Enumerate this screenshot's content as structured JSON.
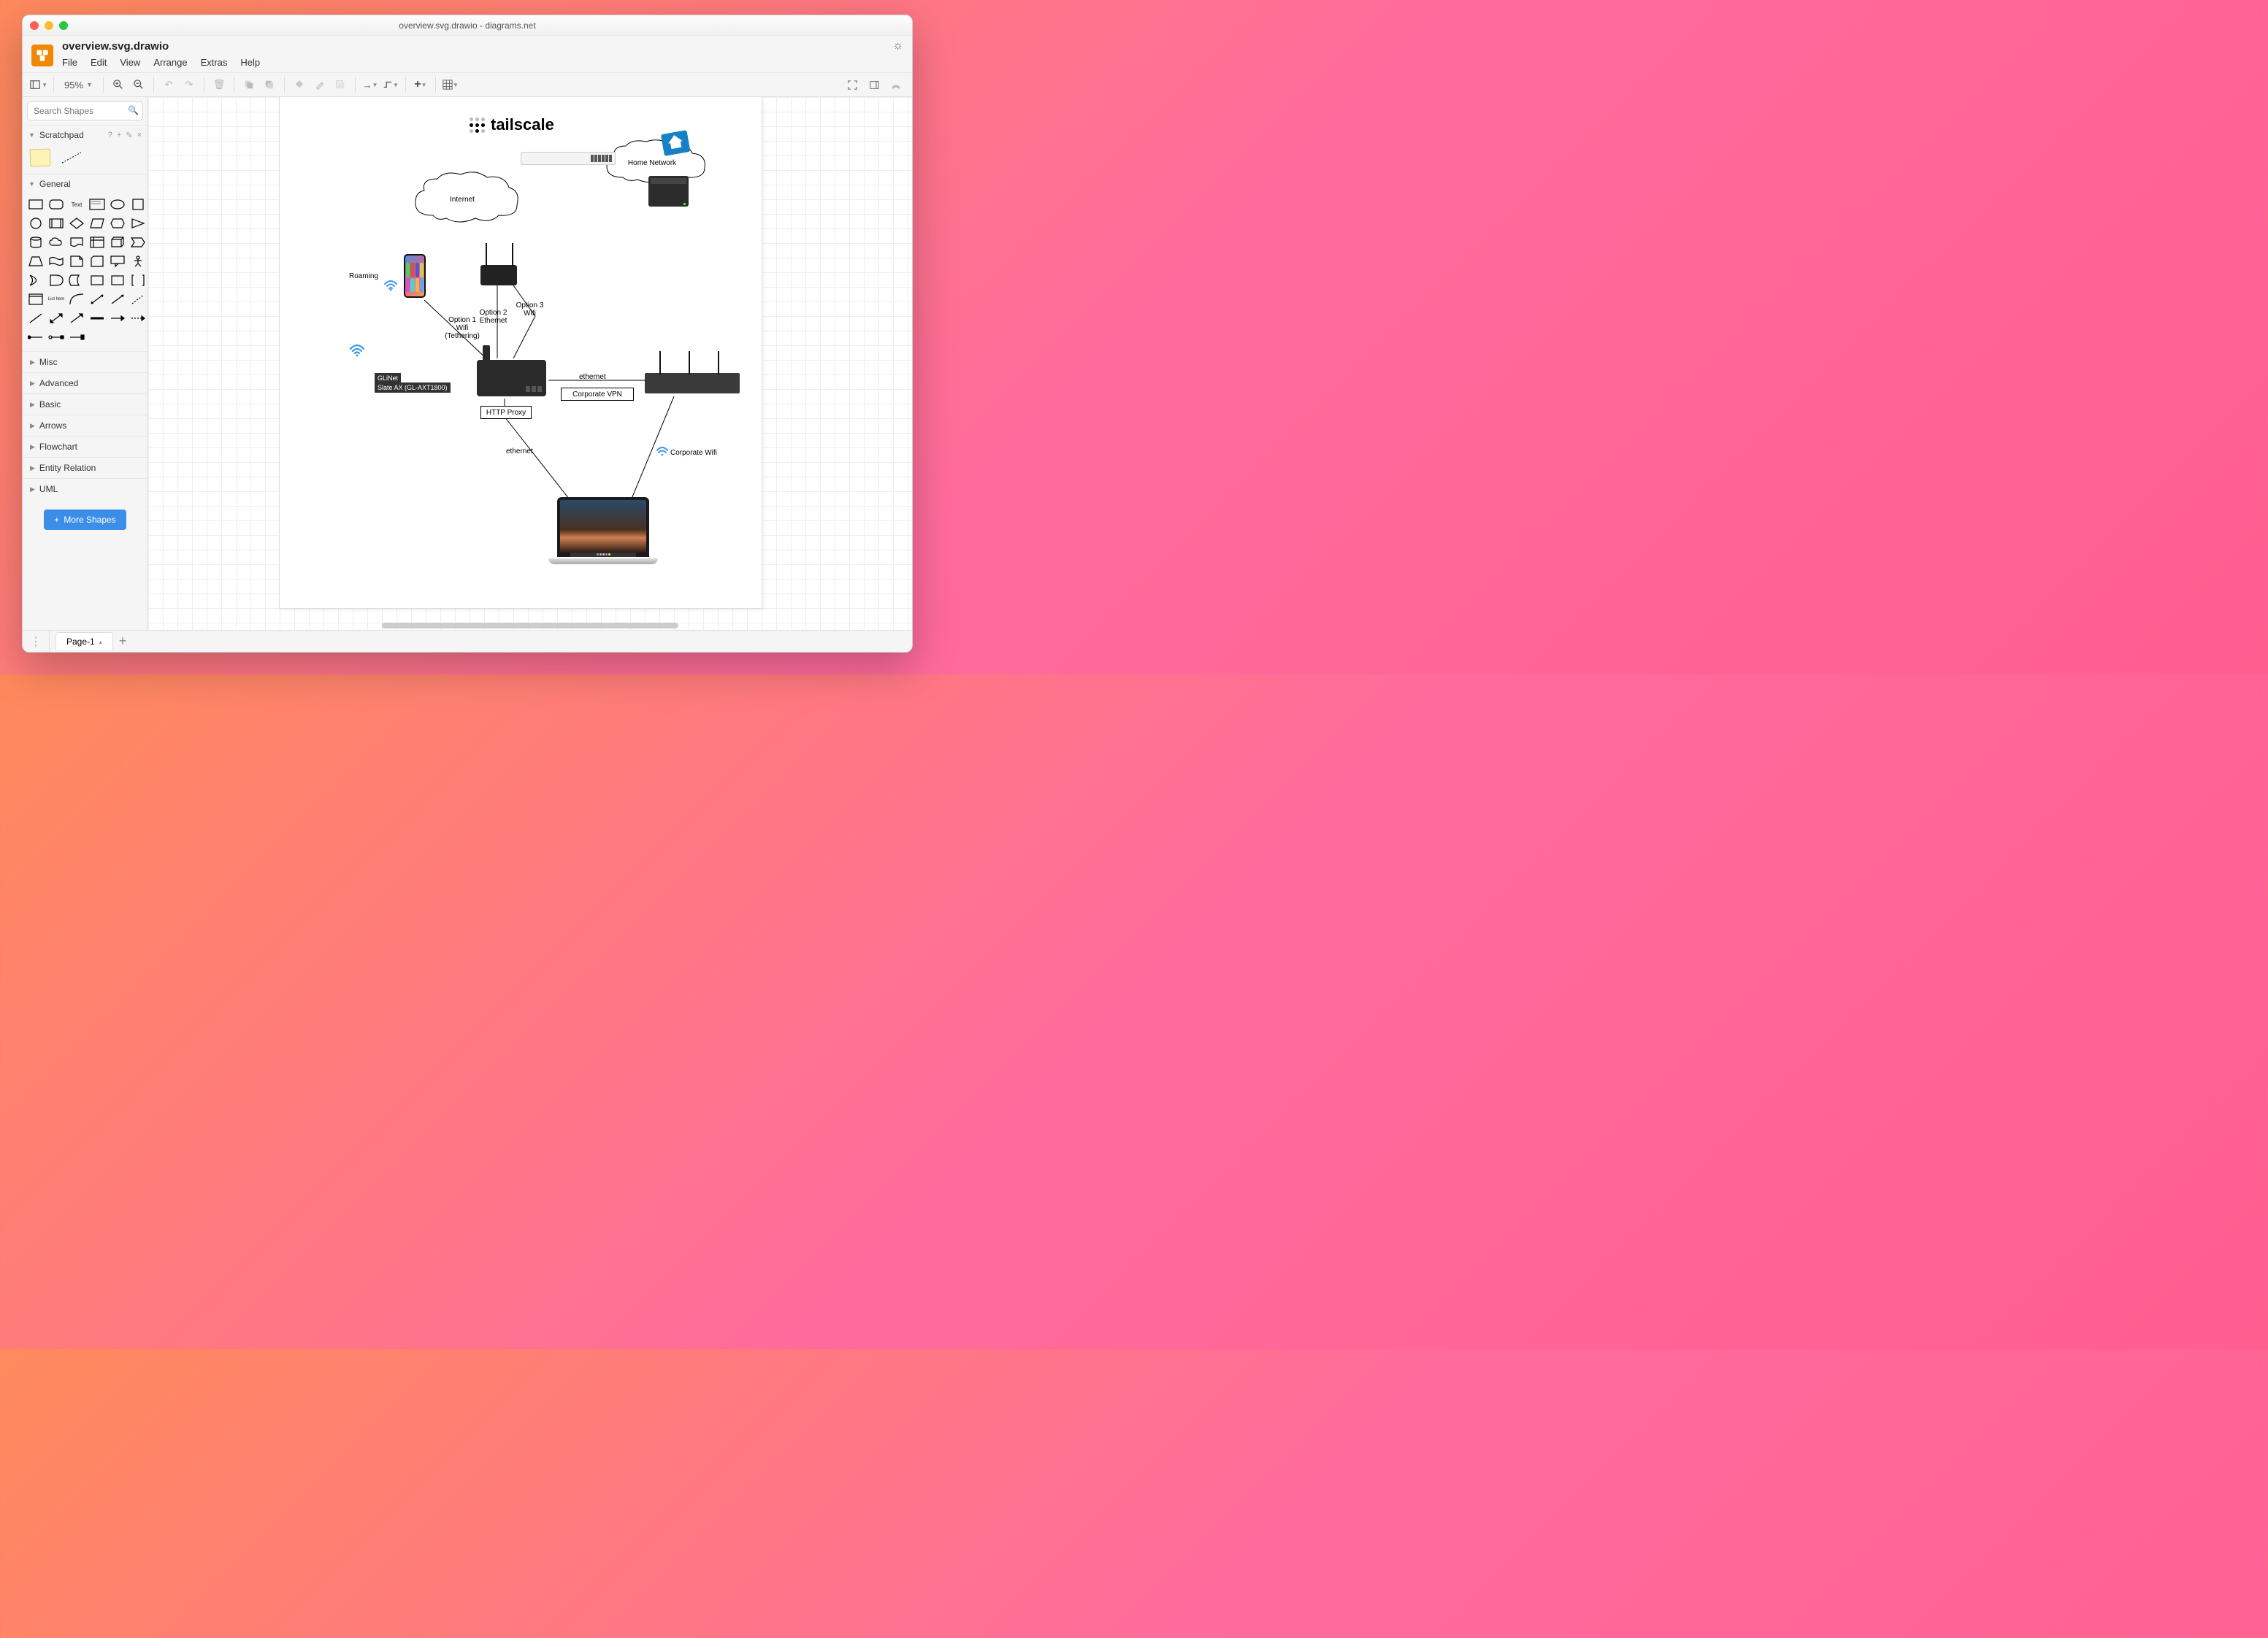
{
  "window": {
    "title": "overview.svg.drawio - diagrams.net"
  },
  "header": {
    "doc_title": "overview.svg.drawio"
  },
  "menubar": [
    "File",
    "Edit",
    "View",
    "Arrange",
    "Extras",
    "Help"
  ],
  "toolbar": {
    "zoom": "95%"
  },
  "sidebar": {
    "search_placeholder": "Search Shapes",
    "scratchpad": {
      "title": "Scratchpad"
    },
    "general_title": "General",
    "categories": [
      "Misc",
      "Advanced",
      "Basic",
      "Arrows",
      "Flowchart",
      "Entity Relation",
      "UML"
    ],
    "more_shapes": "More Shapes"
  },
  "diagram": {
    "logo": "tailscale",
    "cloud_internet": "Internet",
    "cloud_home": "Home Network",
    "roaming": "Roaming",
    "option1": "Option 1\nWifi\n(Tethering)",
    "option2": "Option 2\nEthernet",
    "option3": "Option 3\nWifi",
    "glinet_line1": "GLiNet",
    "glinet_line2": "Slate AX (GL-AXT1800)",
    "ethernet1": "ethernet",
    "ethernet2": "ethernet",
    "corp_vpn": "Corporate VPN",
    "http_proxy": "HTTP Proxy",
    "corp_wifi": "Corporate Wifi"
  },
  "pages": {
    "tab1": "Page-1"
  }
}
